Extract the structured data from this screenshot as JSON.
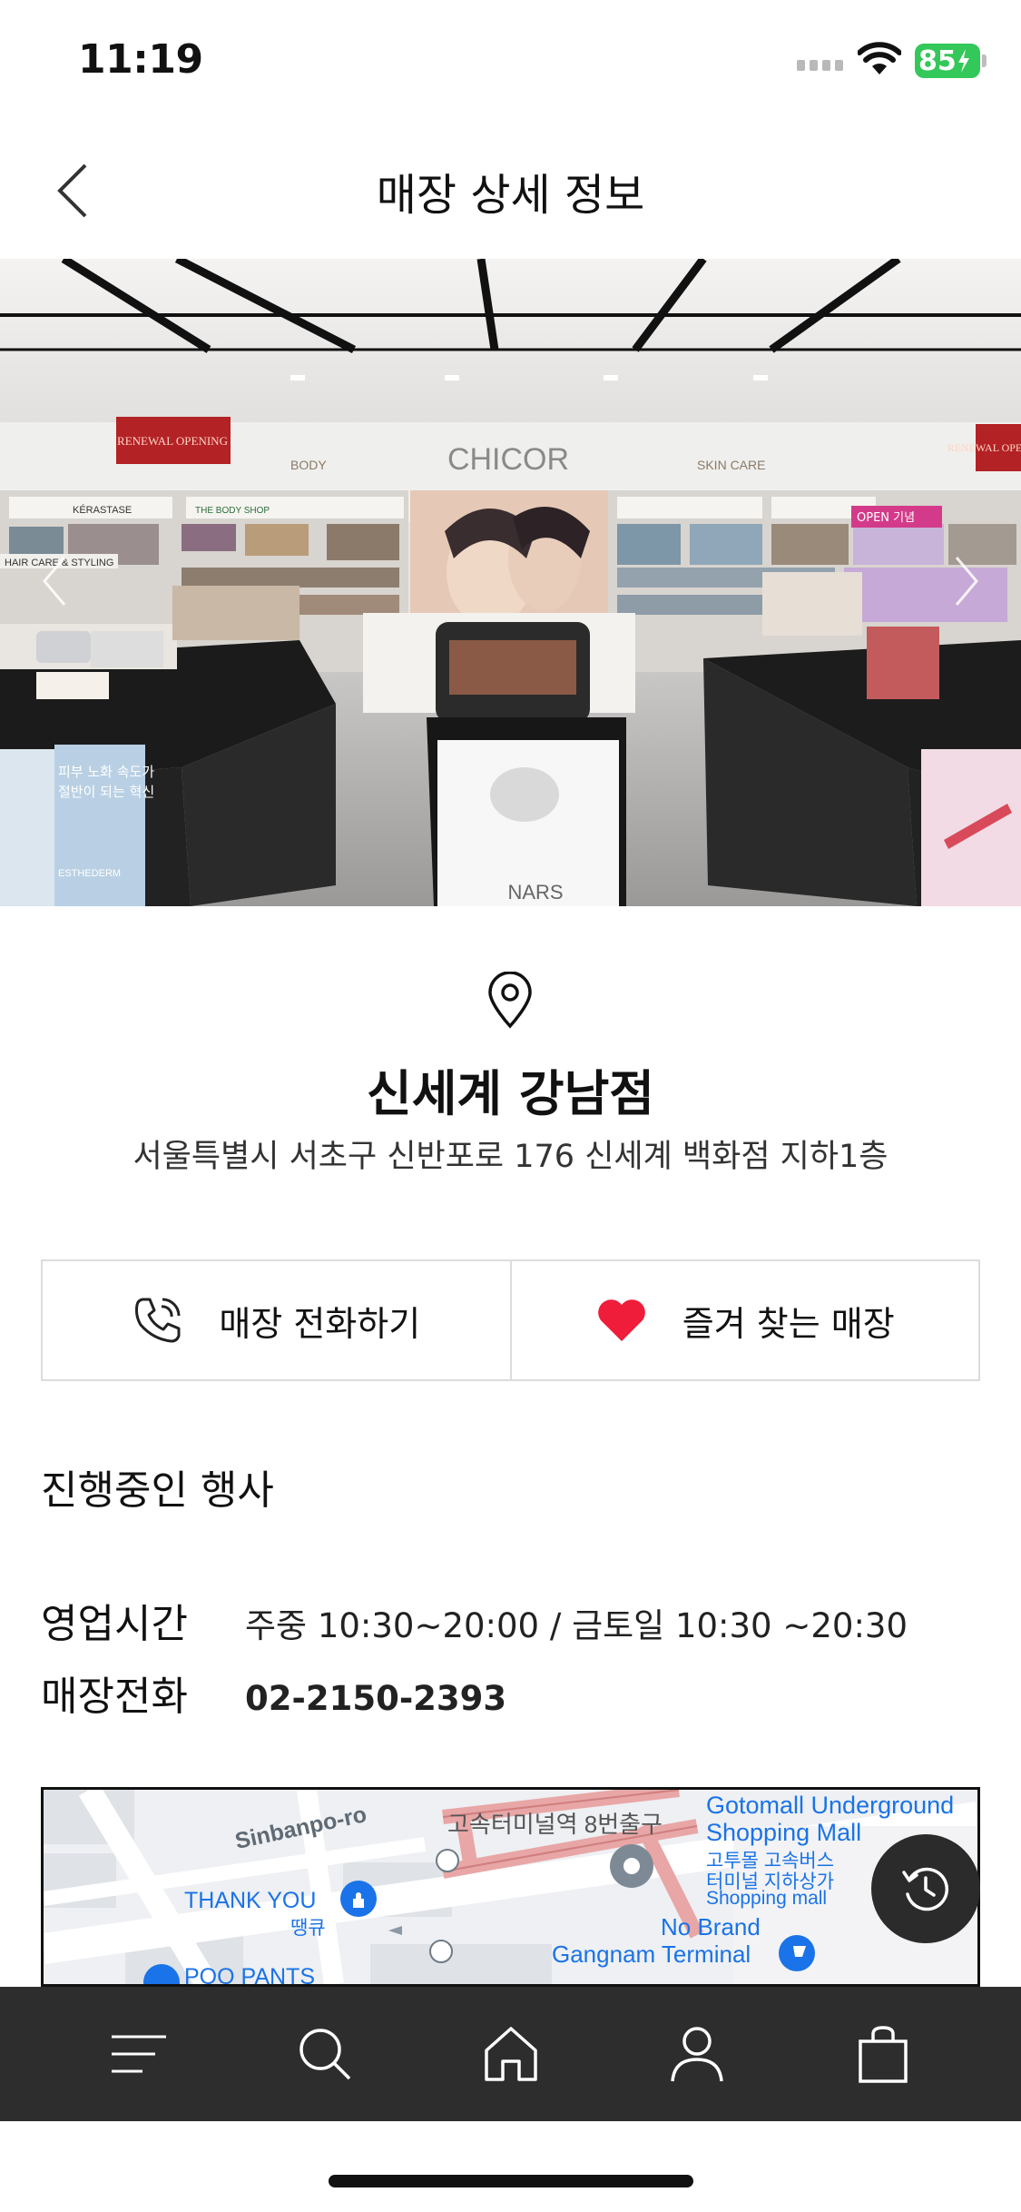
{
  "status_bar": {
    "time": "11:19",
    "battery": "85"
  },
  "header": {
    "title": "매장 상세 정보"
  },
  "hero": {
    "signs": {
      "body": "BODY",
      "brand": "CHICOR",
      "skin_care": "SKIN CARE",
      "renewal_left": "RENEWAL OPENING",
      "renewal_right": "RENEWAL OPENING",
      "kerastase": "KÉRASTASE",
      "the_body_shop": "THE BODY SHOP",
      "hair_care": "HAIR CARE & STYLING",
      "open_event": "OPEN 기념",
      "poster_ko_1": "피부 노화 속도가",
      "poster_ko_2": "절반이 되는 혁신",
      "esthederm": "ESTHEDERM",
      "nars": "NARS"
    }
  },
  "store": {
    "name": "신세계 강남점",
    "address": "서울특별시 서초구 신반포로 176 신세계 백화점 지하1층"
  },
  "actions": {
    "call_label": "매장 전화하기",
    "favorite_label": "즐겨 찾는 매장"
  },
  "events": {
    "title": "진행중인 행사"
  },
  "info": {
    "hours_label": "영업시간",
    "hours_value": "주중 10:30~20:00 / 금토일 10:30 ~20:30",
    "phone_label": "매장전화",
    "phone_value": "02-2150-2393"
  },
  "map": {
    "labels": {
      "sinbanpo": "Sinbanpo-ro",
      "exit8": "고속터미널역 8번출구",
      "gotomall_en_1": "Gotomall Underground",
      "gotomall_en_2": "Shopping Mall",
      "gotomall_ko_1": "고투몰 고속버스",
      "gotomall_ko_2": "터미널 지하상가",
      "gotomall_ko_3": "Shopping mall",
      "thankyou": "THANK YOU",
      "ttangkyu": "땡큐",
      "noBrand": "No Brand",
      "terminal": "Gangnam Terminal",
      "poo": "POO PANTS"
    }
  },
  "colors": {
    "accent_heart": "#ef1c3a",
    "nav_bg": "#2d2d2d",
    "battery_green": "#34c759",
    "map_blue": "#1a73e8",
    "map_route": "#e8a6a6"
  },
  "icons": {
    "back": "chevron-left-icon",
    "location": "map-pin-icon",
    "phone": "phone-icon",
    "heart": "heart-icon",
    "history": "history-icon",
    "nav": [
      "menu-icon",
      "search-icon",
      "home-icon",
      "user-icon",
      "bag-icon"
    ]
  }
}
